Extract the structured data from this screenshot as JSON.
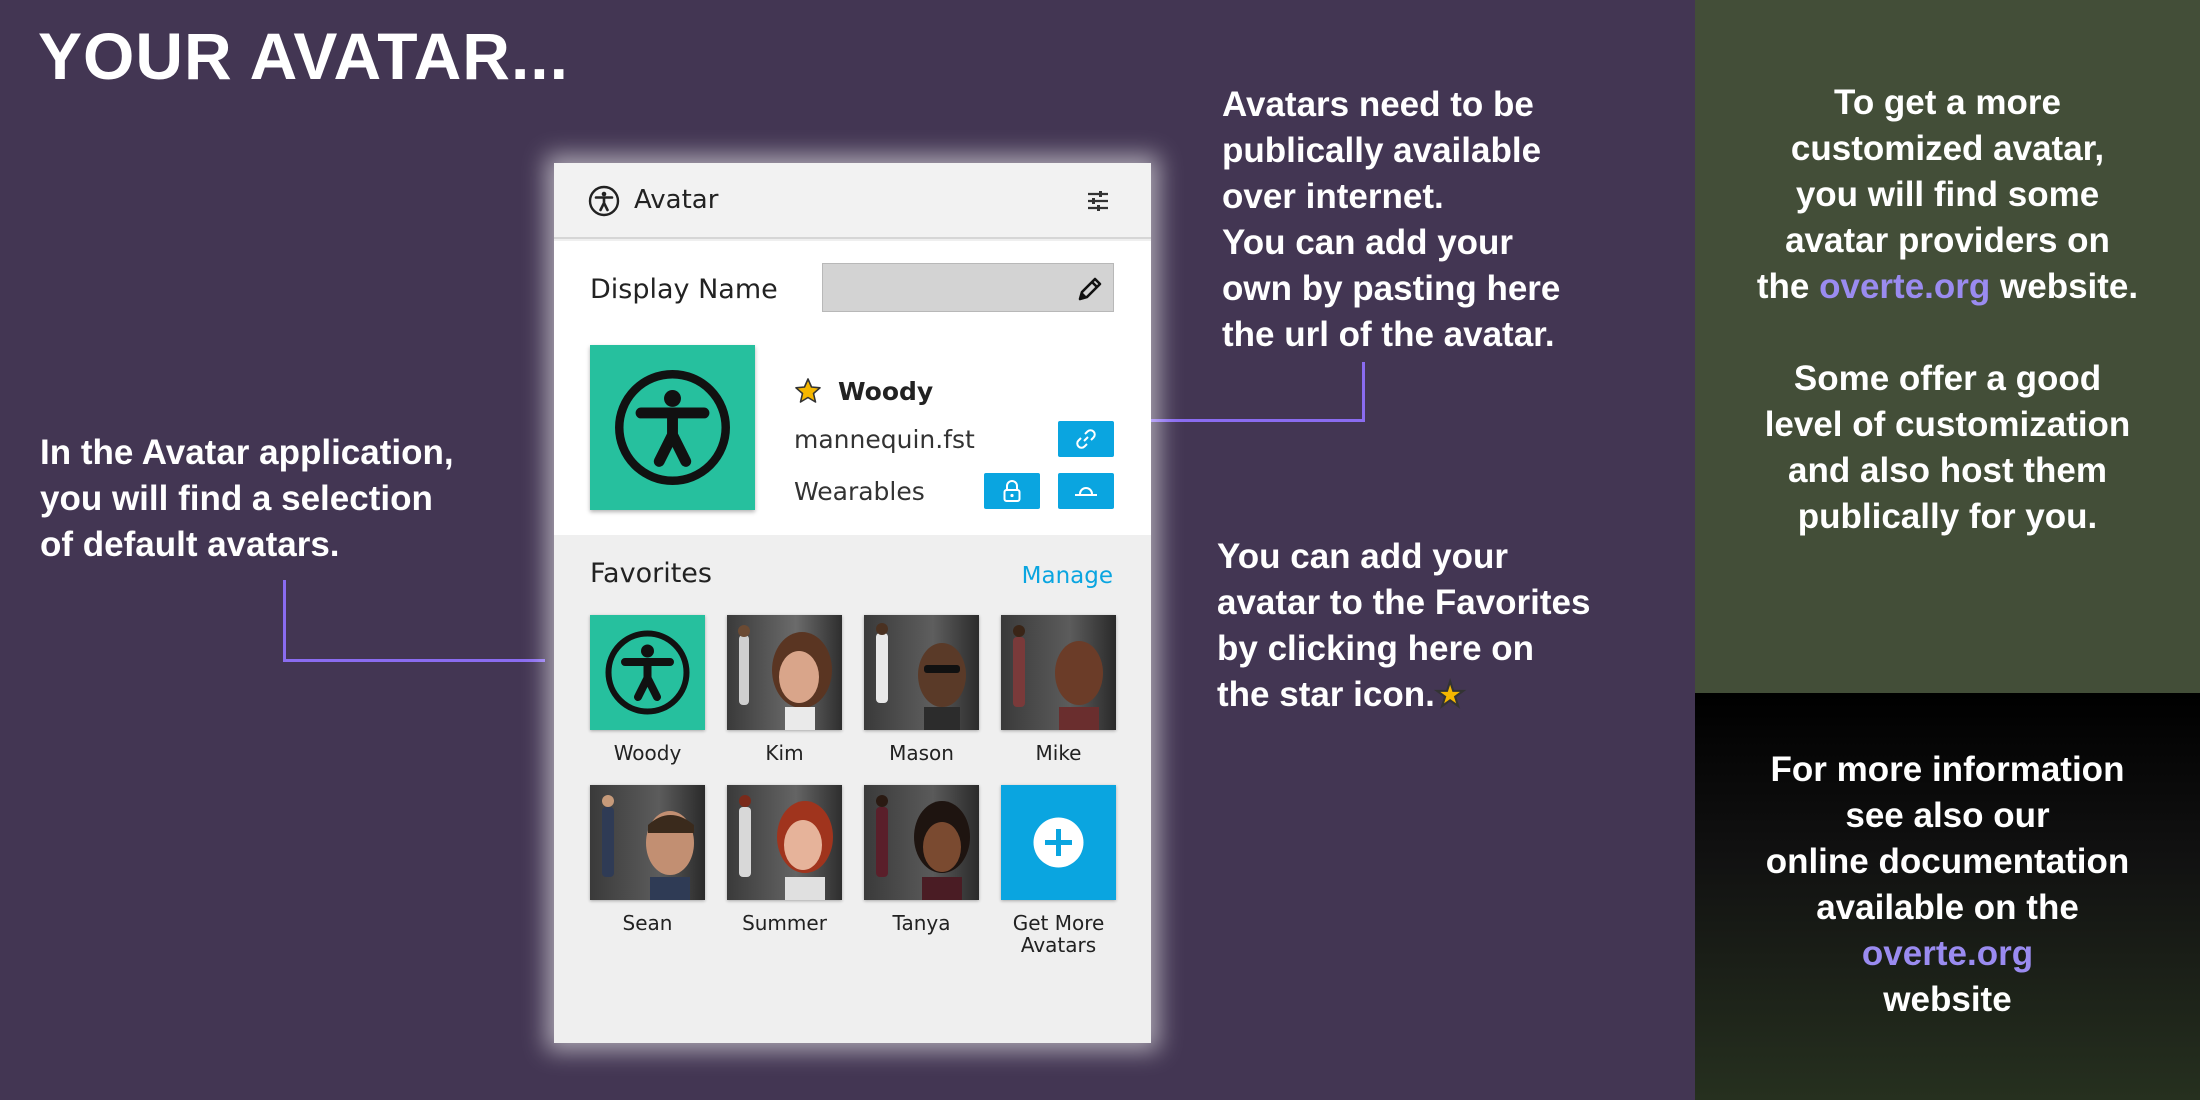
{
  "slide": {
    "title": "YOUR AVATAR...",
    "note_left": "In the Avatar application,\nyou will find a selection\nof default avatars.",
    "note_top": "Avatars need to be\npublically available\nover internet.\nYou can add your\nown by pasting here\nthe url of the avatar.",
    "note_mid": "You can add your\navatar to the Favorites\nby clicking here on\nthe star icon."
  },
  "side_green": {
    "p1_line1": "To get a more",
    "p1_line2": "customized avatar,",
    "p1_line3": "you will find some",
    "p1_line4": "avatar providers on",
    "p1_pre": "the ",
    "p1_link": "overte.org",
    "p1_post": " website.",
    "p2": "Some offer a good\nlevel of customization\nand also host them\npublically for you."
  },
  "side_dark": {
    "line1": "For more information",
    "line2": "see also our",
    "line3": "online documentation",
    "line4": "available on the",
    "link": "overte.org",
    "line5": "website"
  },
  "app": {
    "title": "Avatar",
    "display_name_label": "Display Name",
    "display_name_value": "",
    "current_avatar": {
      "name": "Woody",
      "file": "mannequin.fst",
      "wearables_label": "Wearables"
    },
    "favorites_label": "Favorites",
    "manage_label": "Manage",
    "favorites": [
      {
        "name": "Woody"
      },
      {
        "name": "Kim"
      },
      {
        "name": "Mason"
      },
      {
        "name": "Mike"
      },
      {
        "name": "Sean"
      },
      {
        "name": "Summer"
      },
      {
        "name": "Tanya"
      },
      {
        "name": "Get More\nAvatars"
      }
    ]
  },
  "colors": {
    "background": "#433653",
    "green_panel": "#434e38",
    "accent_blue": "#0aa5e0",
    "avatar_teal": "#26c09e",
    "link_purple": "#9a8bf0",
    "connector": "#8a6cf0",
    "star": "#f5b700"
  }
}
